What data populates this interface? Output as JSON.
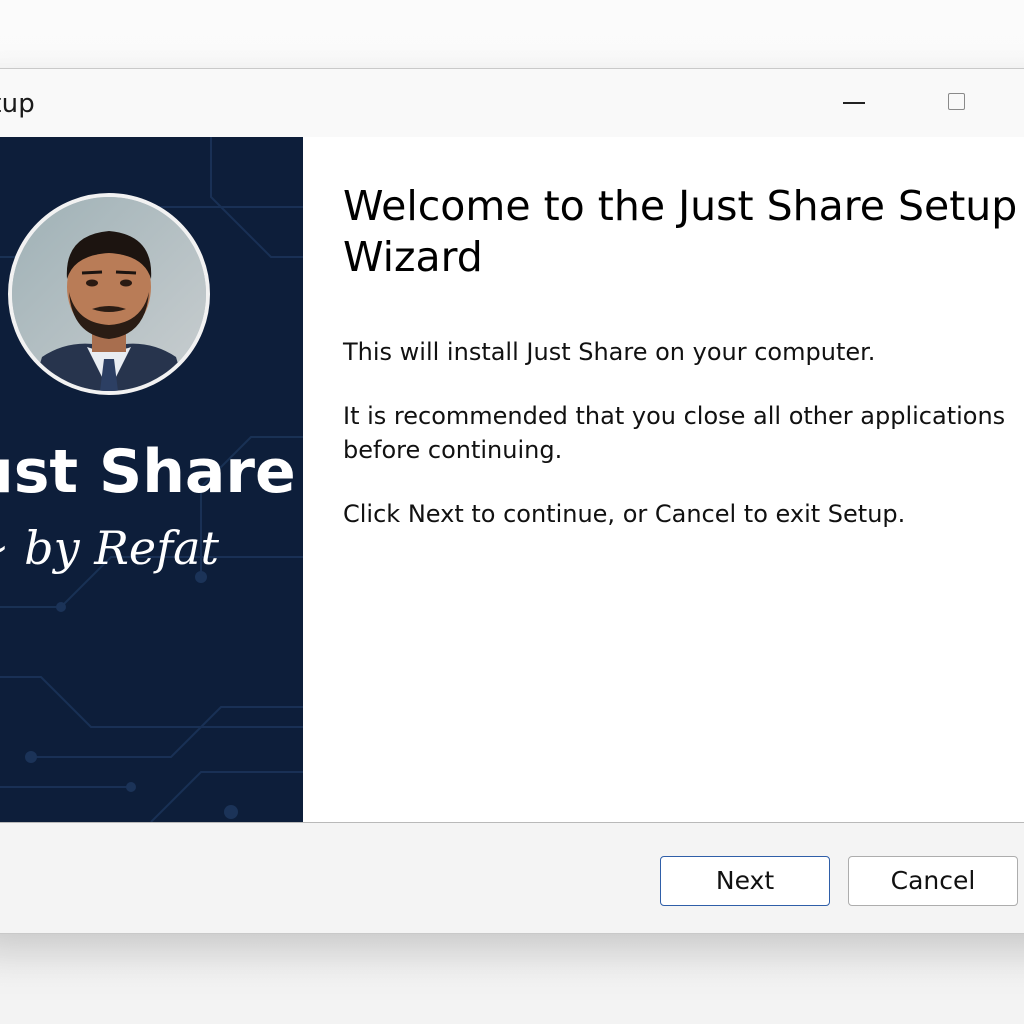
{
  "window": {
    "title": "etup"
  },
  "banner": {
    "app_name": "ust Share",
    "byline": "~ by Refat",
    "avatar_alt": "developer portrait",
    "background_color": "#0d1e3a"
  },
  "content": {
    "heading": "Welcome to the Just Share Setup Wizard",
    "paragraphs": [
      "This will install Just Share on your computer.",
      "It is recommended that you close all other applications before continuing.",
      "Click Next to continue, or Cancel to exit Setup."
    ]
  },
  "footer": {
    "next_label": "Next",
    "cancel_label": "Cancel"
  },
  "icons": {
    "minimize": "minimize-icon",
    "maximize": "maximize-icon"
  },
  "colors": {
    "accent": "#2f5ea8"
  }
}
